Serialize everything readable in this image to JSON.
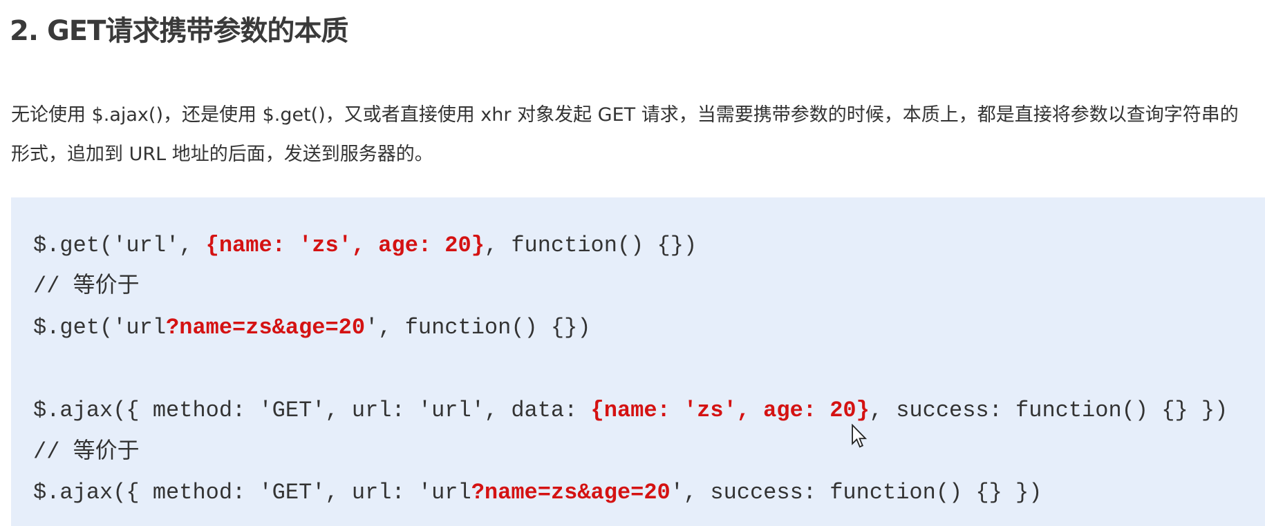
{
  "heading": "2. GET请求携带参数的本质",
  "paragraph": "无论使用 $.ajax()，还是使用 $.get()，又或者直接使用 xhr 对象发起 GET 请求，当需要携带参数的时候，本质上，都是直接将参数以查询字符串的形式，追加到 URL 地址的后面，发送到服务器的。",
  "code": {
    "line1": {
      "pre": "$.get('url', ",
      "hl": "{name: 'zs', age: 20}",
      "post": ", function() {})"
    },
    "line2": "// 等价于",
    "line3": {
      "pre": "$.get('url",
      "hl": "?name=zs&age=20",
      "post": "', function() {})"
    },
    "line4": {
      "pre": "$.ajax({ method: 'GET', url: 'url', data: ",
      "hl": "{name: 'zs', age: 20}",
      "post": ", success: function() {} })"
    },
    "line5": "// 等价于",
    "line6": {
      "pre": "$.ajax({ method: 'GET', url: 'url",
      "hl": "?name=zs&age=20",
      "post": "', success: function() {} })"
    }
  },
  "colors": {
    "highlight": "#d41212",
    "code_bg": "#e6eefa",
    "text": "#333333"
  },
  "icons": {
    "cursor": "mouse-pointer-icon"
  }
}
